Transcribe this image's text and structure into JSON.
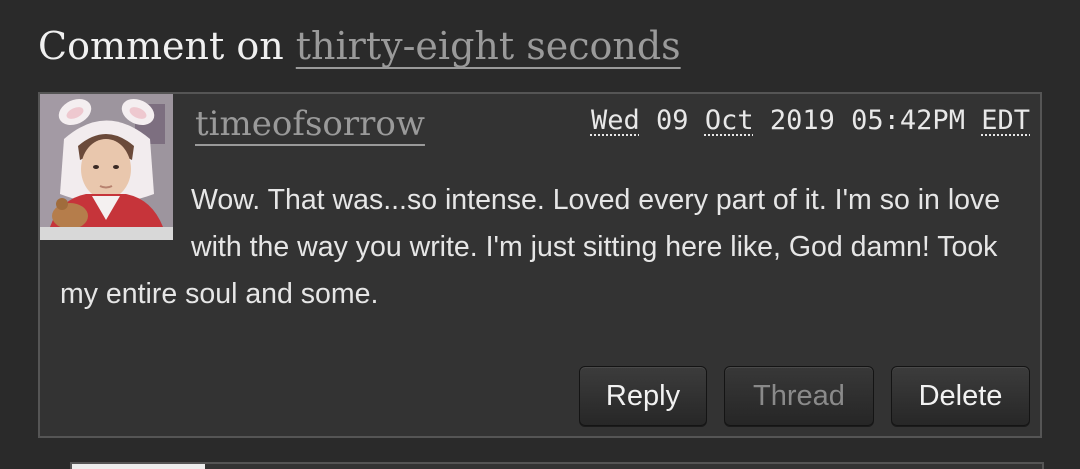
{
  "heading": {
    "prefix": "Comment on",
    "work_title": "thirty-eight seconds"
  },
  "comment": {
    "username": "timeofsorrow",
    "date": {
      "weekday": "Wed",
      "day": "09",
      "month": "Oct",
      "year": "2019",
      "time": "05:42PM",
      "timezone": "EDT"
    },
    "text": "Wow. That was...so intense. Loved every part of it. I'm so in love with the way you write. I'm just sitting here like, God damn! Took my entire soul and some.",
    "buttons": {
      "reply": "Reply",
      "thread": "Thread",
      "delete": "Delete"
    }
  },
  "colors": {
    "background": "#2a2a2a",
    "panel": "#333333",
    "border": "#555555",
    "link": "#9a9a9a",
    "text": "#e6e6e6"
  },
  "icons": {
    "avatar": "user-avatar-image"
  }
}
